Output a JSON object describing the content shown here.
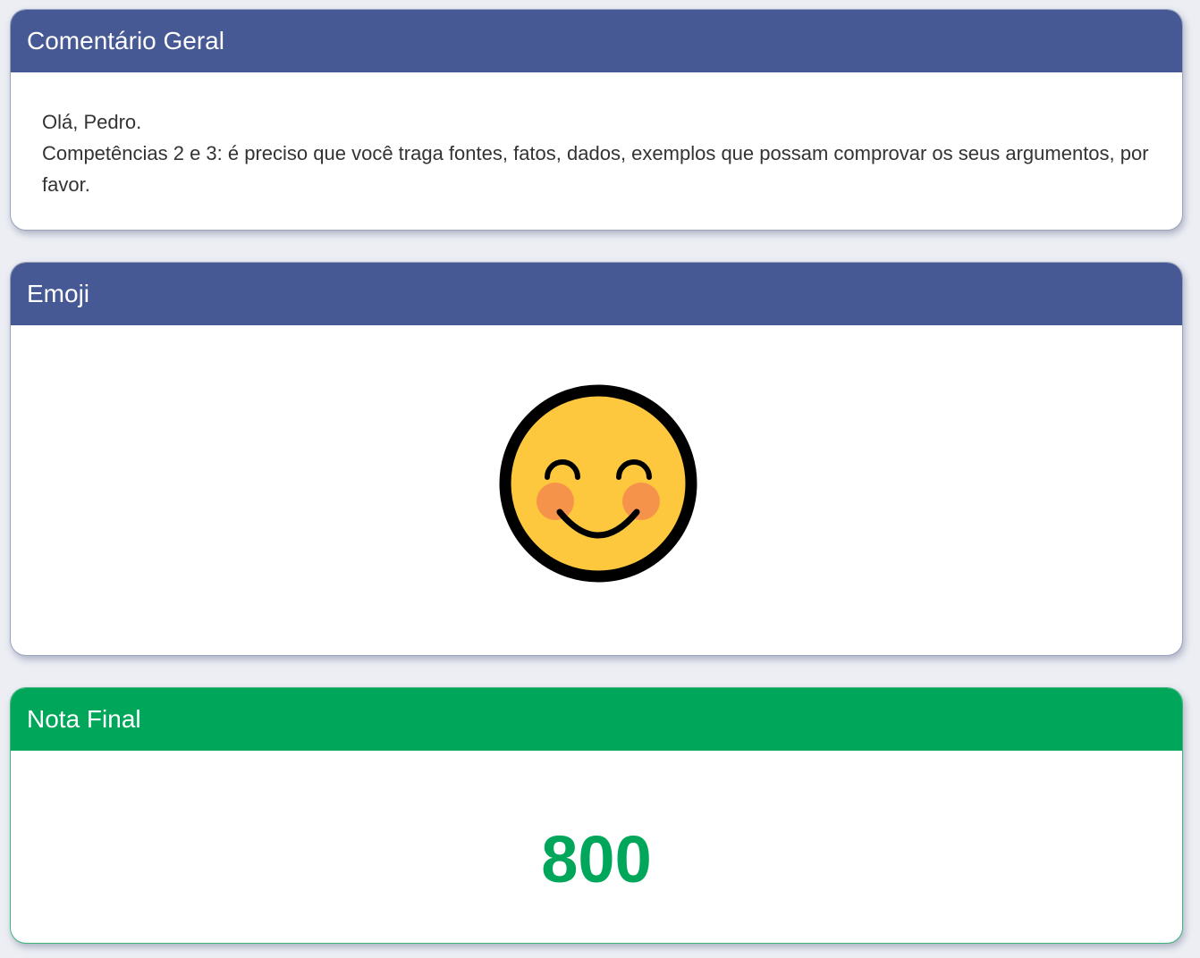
{
  "theme": {
    "header_blue": "#465994",
    "header_green": "#00a65a",
    "grade_color": "#00a65a",
    "emoji_face": "#fdc83e",
    "emoji_cheek": "#f58a4e"
  },
  "comment_card": {
    "title": "Comentário Geral",
    "lines": [
      "Olá, Pedro.",
      "Competências 2 e 3: é preciso que você traga fontes, fatos, dados, exemplos que possam comprovar os seus argumentos, por favor."
    ]
  },
  "emoji_card": {
    "title": "Emoji",
    "emoji_icon": "smiling-face-with-smiling-eyes-icon"
  },
  "grade_card": {
    "title": "Nota Final",
    "value": "800"
  }
}
